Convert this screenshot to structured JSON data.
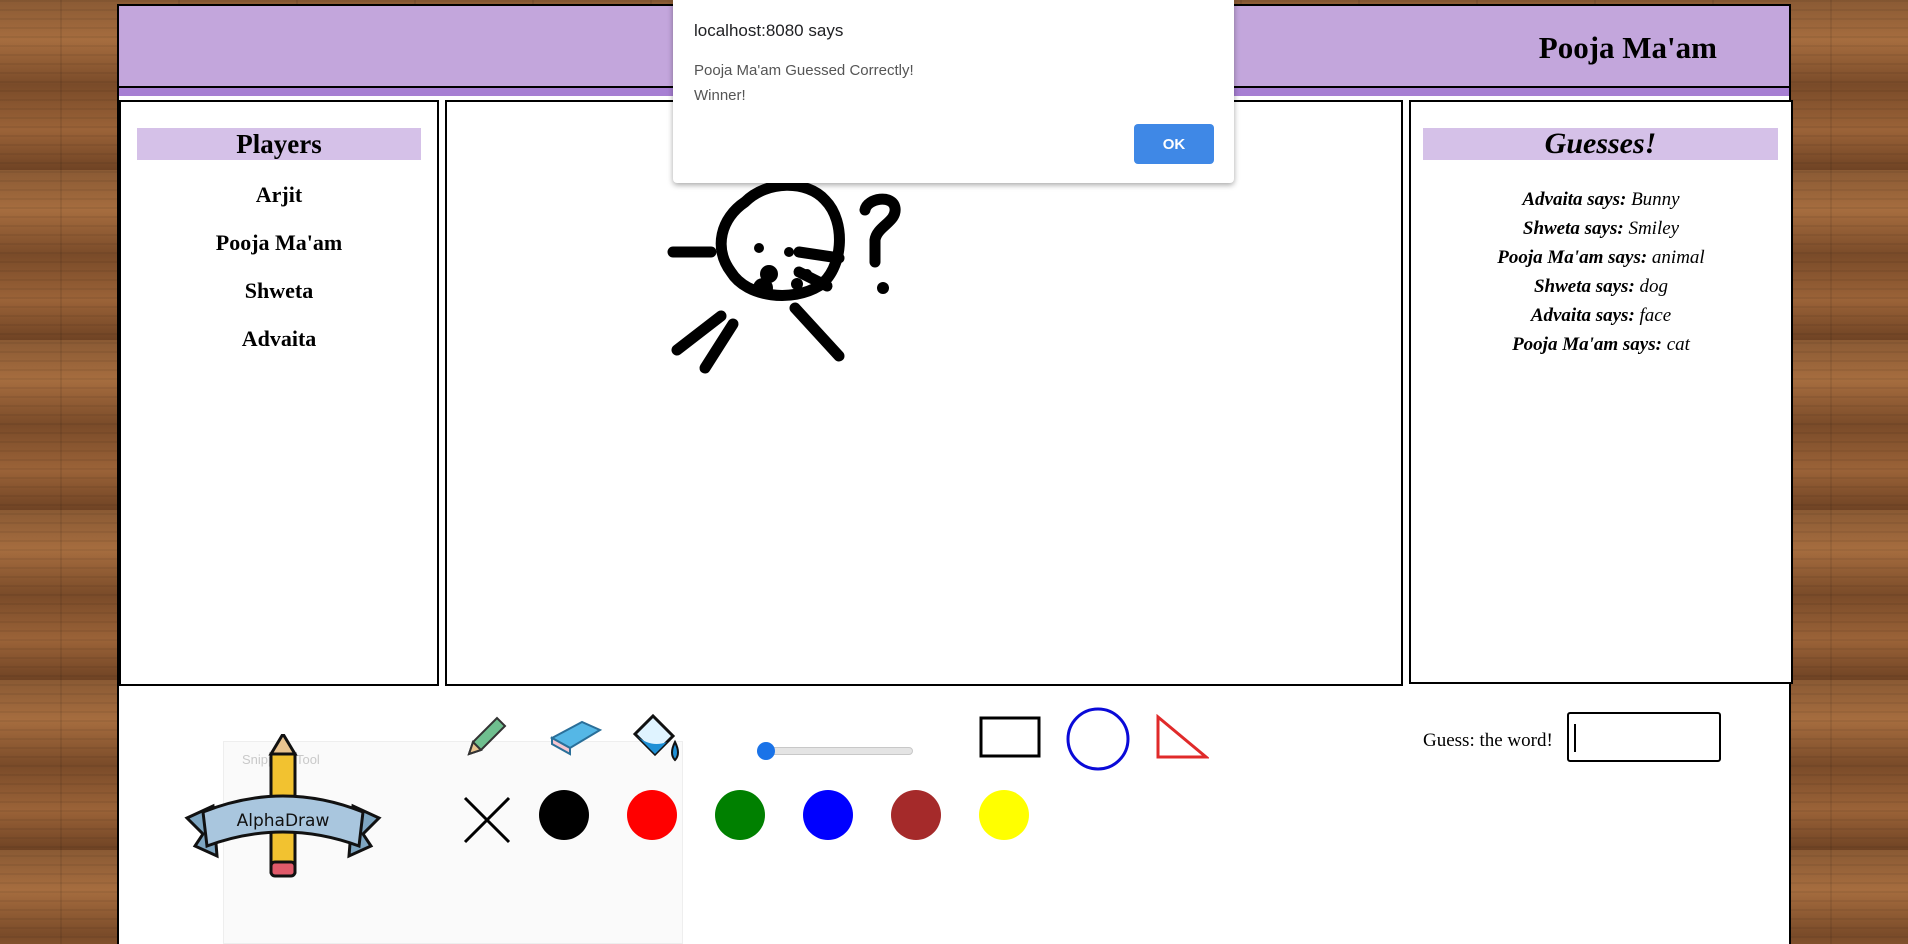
{
  "header": {
    "current_user": "Pooja Ma'am"
  },
  "players": {
    "title": "Players",
    "items": [
      "Arjit",
      "Pooja Ma'am",
      "Shweta",
      "Advaita"
    ]
  },
  "guesses": {
    "title": "Guesses!",
    "items": [
      {
        "who": "Advaita says:",
        "word": "Bunny"
      },
      {
        "who": "Shweta says:",
        "word": "Smiley"
      },
      {
        "who": "Pooja Ma'am says:",
        "word": "animal"
      },
      {
        "who": "Shweta says:",
        "word": "dog"
      },
      {
        "who": "Advaita says:",
        "word": "face"
      },
      {
        "who": "Pooja Ma'am says:",
        "word": "cat"
      }
    ]
  },
  "toolbar": {
    "logo_text": "AlphaDraw",
    "faded_panel_text": "Snipping Tool",
    "tools": [
      "pencil-icon",
      "eraser-icon",
      "fill-bucket-icon"
    ],
    "shapes": [
      "rectangle-icon",
      "circle-icon",
      "triangle-icon"
    ],
    "brush_size": 0,
    "colors": [
      "#000000",
      "#ff0000",
      "#008000",
      "#0000ff",
      "#a52a2a",
      "#ffff00"
    ],
    "guess_label": "Guess: the word!",
    "guess_value": ""
  },
  "dialog": {
    "title": "localhost:8080 says",
    "message_line1": "Pooja Ma'am Guessed Correctly!",
    "message_line2": "Winner!",
    "ok_label": "OK"
  }
}
